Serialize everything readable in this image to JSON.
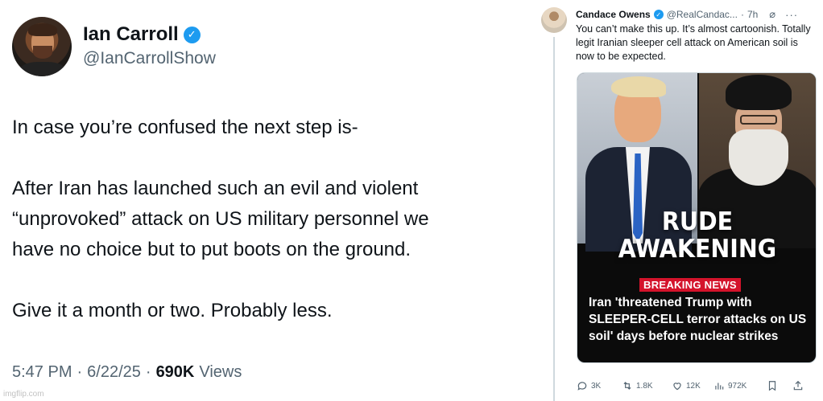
{
  "left_tweet": {
    "author_name": "Ian Carroll",
    "handle": "@IanCarrollShow",
    "body": [
      "In case you’re confused the next step is-",
      "",
      "After Iran has launched such an evil and violent",
      "“unprovoked” attack on US military personnel we",
      "have no choice but to put boots on the ground.",
      "",
      "Give it a month or two. Probably less."
    ],
    "time": "5:47 PM",
    "date": "6/22/25",
    "views_count": "690K",
    "views_label": "Views"
  },
  "right_tweet": {
    "author_name": "Candace Owens",
    "handle": "@RealCandac...",
    "time": "7h",
    "body": "You can’t make this up. It’s almost cartoonish. Totally legit Iranian sleeper cell attack on American soil is now to be expected.",
    "media": {
      "headline_line1": "RUDE",
      "headline_line2": "AWAKENING",
      "badge": "BREAKING NEWS",
      "story": "Iran 'threatened Trump with SLEEPER-CELL terror attacks on US soil' days before nuclear strikes"
    },
    "actions": {
      "replies": "3K",
      "reposts": "1.8K",
      "likes": "12K",
      "views": "972K"
    }
  },
  "watermark": "imgflip.com",
  "icons": {
    "verified": "verified-badge-icon",
    "grok": "grok-icon",
    "more": "more-icon",
    "reply": "reply-icon",
    "repost": "repost-icon",
    "like": "like-icon",
    "views": "views-icon",
    "bookmark": "bookmark-icon"
  },
  "colors": {
    "verified": "#1d9bf0",
    "breaking_badge": "#d4132b",
    "secondary_text": "#536471"
  }
}
